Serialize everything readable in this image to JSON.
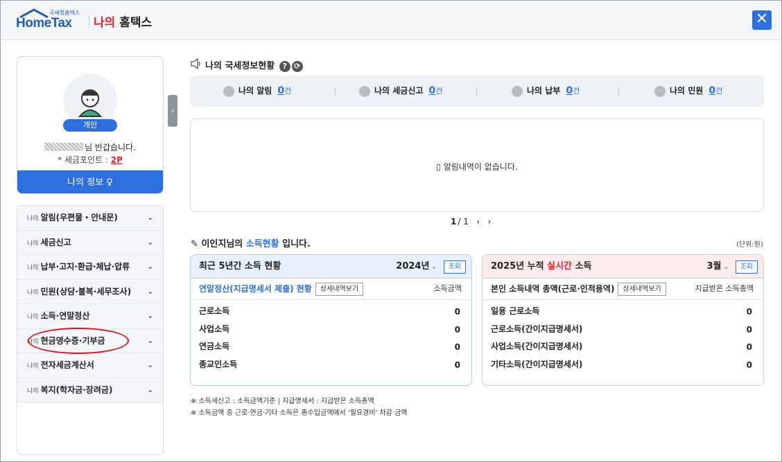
{
  "header": {
    "logo_small": "국세청홈택스",
    "logo_main": "HomeTax",
    "title_red": "나의",
    "title_rest": " 홈택스",
    "close_label": "✕"
  },
  "profile": {
    "badge": "개인",
    "greeting": "님 반갑습니다.",
    "points_label": "* 세금포인트 : ",
    "points_value": "2P",
    "my_info": "나의 정보 ♀"
  },
  "menu": {
    "items": [
      {
        "prefix": "나의",
        "label": "알림(우편물・안내문)"
      },
      {
        "prefix": "나의",
        "label": "세금신고"
      },
      {
        "prefix": "나의",
        "label": "납부·고지·환급·체납·압류"
      },
      {
        "prefix": "나의",
        "label": "민원(상담·불복·세무조사)"
      },
      {
        "prefix": "나의",
        "label": "소득·연말정산"
      },
      {
        "prefix": "나의",
        "label": "현금영수증·기부금"
      },
      {
        "prefix": "나의",
        "label": "전자세금계산서"
      },
      {
        "prefix": "나의",
        "label": "복지(학자금·장려금)"
      }
    ],
    "chevron": "⌄"
  },
  "status": {
    "title": "나의 국세정보현황",
    "help": "?",
    "refresh": "⟳",
    "items": [
      {
        "label": "나의 알림",
        "count": "0",
        "unit": "건"
      },
      {
        "label": "나의 세금신고",
        "count": "0",
        "unit": "건"
      },
      {
        "label": "나의 납부",
        "count": "0",
        "unit": "건"
      },
      {
        "label": "나의 민원",
        "count": "0",
        "unit": "건"
      }
    ]
  },
  "notice": {
    "empty": "▯ 알림내역이 없습니다."
  },
  "pager": {
    "current": "1",
    "total": "/ 1",
    "prev": "‹",
    "next": "›"
  },
  "income": {
    "title_pre": "이인지님의 ",
    "title_blue": "소득현황",
    "title_post": " 입니다.",
    "unit_note": "(단위:원)"
  },
  "card1": {
    "title": "최근 5년간 소득 현황",
    "year": "2024년",
    "search": "조회",
    "sub_title": "연말정산(지급명세서 제출) 현황",
    "detail_btn": "상세내역보기",
    "col_header": "소득금액",
    "rows": [
      {
        "label": "근로소득",
        "value": "0"
      },
      {
        "label": "사업소득",
        "value": "0"
      },
      {
        "label": "연금소득",
        "value": "0"
      },
      {
        "label": "종교인소득",
        "value": "0"
      }
    ]
  },
  "card2": {
    "title_pre": "2025년 누적 ",
    "title_red": "실시간",
    "title_post": " 소득",
    "month": "3월",
    "search": "조회",
    "sub_title": "본인 소득내역 총액(근로·인적용역)",
    "detail_btn": "상세내역보기",
    "col_header": "지급받은 소득총액",
    "rows": [
      {
        "label": "일용 근로소득",
        "value": "0"
      },
      {
        "label": "근로소득(간이지급명세서)",
        "value": "0"
      },
      {
        "label": "사업소득(간이지급명세서)",
        "value": "0"
      },
      {
        "label": "기타소득(간이지급명세서)",
        "value": "0"
      }
    ]
  },
  "footnotes": [
    "※ 소득세신고 : 소득금액기준  |  지급명세서 : 지급받은 소득총액",
    "※ 소득금액 중 근로·연금·기타 소득은 총수입금액에서 '필요경비' 차감 금액"
  ],
  "colors": {
    "accent": "#2e6fde",
    "red": "#e2242d"
  }
}
